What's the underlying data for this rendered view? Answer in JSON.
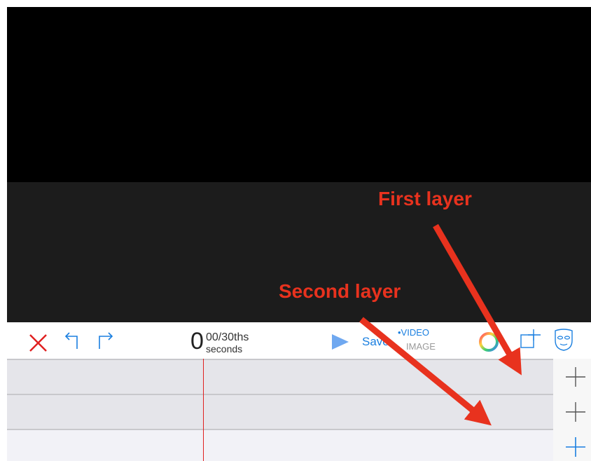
{
  "toolbar": {
    "close_icon": "close-icon",
    "undo_icon": "undo-icon",
    "redo_icon": "redo-icon",
    "time": {
      "big": "0",
      "frac": "00/30ths",
      "unit": "seconds"
    },
    "play_icon": "play-icon",
    "save_label": "Save",
    "mode": {
      "video": "•VIDEO",
      "image": "IMAGE",
      "selected": "VIDEO"
    },
    "color_icon": "color-wheel-icon",
    "crop_icon": "add-frame-icon",
    "mask_icon": "mask-icon"
  },
  "timeline": {
    "tracks": [
      "layer-1",
      "layer-2",
      "layer-3"
    ],
    "add_buttons": [
      "add-layer",
      "add-layer",
      "add-layer"
    ]
  },
  "annotations": {
    "first": "First layer",
    "second": "Second layer"
  },
  "colors": {
    "accent": "#1a7fe0",
    "close_red": "#e02020",
    "annotation_red": "#e8321e",
    "playhead": "#e02020"
  }
}
